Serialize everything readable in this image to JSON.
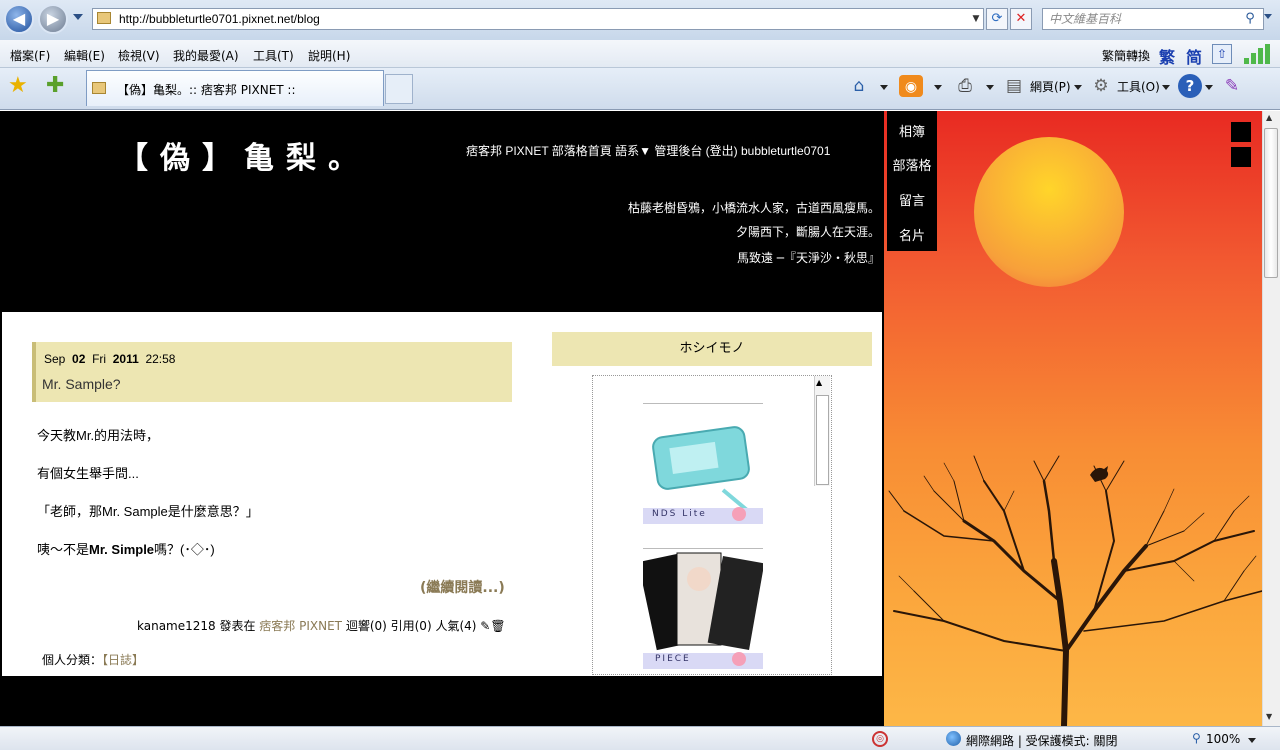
{
  "browser": {
    "url": "http://bubbleturtle0701.pixnet.net/blog",
    "search_placeholder": "中文維基百科",
    "menu": [
      "檔案(F)",
      "編輯(E)",
      "檢視(V)",
      "我的最愛(A)",
      "工具(T)",
      "說明(H)"
    ],
    "convert_label": "繁簡轉換",
    "trad": "繁",
    "simp": "简",
    "tab_title": "【偽】亀梨。:: 痞客邦 PIXNET ::",
    "page_label": "網頁(P)",
    "tools_label": "工具(O)",
    "status_zone": "網際網路 | 受保護模式: 關閉",
    "zoom": "100%"
  },
  "blog": {
    "title": "【偽】亀梨。",
    "top_links": "痞客邦 PIXNET 部落格首頁 語系▼ 管理後台 (登出) bubbleturtle0701",
    "poem": [
      "枯藤老樹昏鴉，小橋流水人家，古道西風瘦馬。",
      "夕陽西下，斷腸人在天涯。",
      "馬致遠 ─『天淨沙・秋思』"
    ],
    "side_nav": [
      "相簿",
      "部落格",
      "留言",
      "名片"
    ]
  },
  "post": {
    "date_month": "Sep",
    "date_day": "02",
    "date_wd": "Fri",
    "date_year": "2011",
    "date_time": "22:58",
    "title": "Mr. Sample?",
    "lines": [
      "今天教Mr.的用法時，",
      "有個女生舉手問...",
      "「老師，那Mr. Sample是什麼意思？」"
    ],
    "line4_pre": "咦～不是",
    "line4_bold": "Mr. Simple",
    "line4_post": "嗎？(･◇･)",
    "read_more": "(繼續閱讀...)",
    "meta_author": "kaname1218 發表在 ",
    "meta_link": "痞客邦 PIXNET",
    "meta_stats": " 迴響(0) 引用(0) 人氣(4)",
    "category_label": "個人分類：",
    "category_value": "【日誌】"
  },
  "sidebar": {
    "widget_title": "ホシイモノ",
    "item1_caption": "NDS Lite",
    "item2_caption": "PIECE"
  },
  "colors": {
    "accent_panel": "#ede6b2",
    "link": "#8a7a55"
  }
}
